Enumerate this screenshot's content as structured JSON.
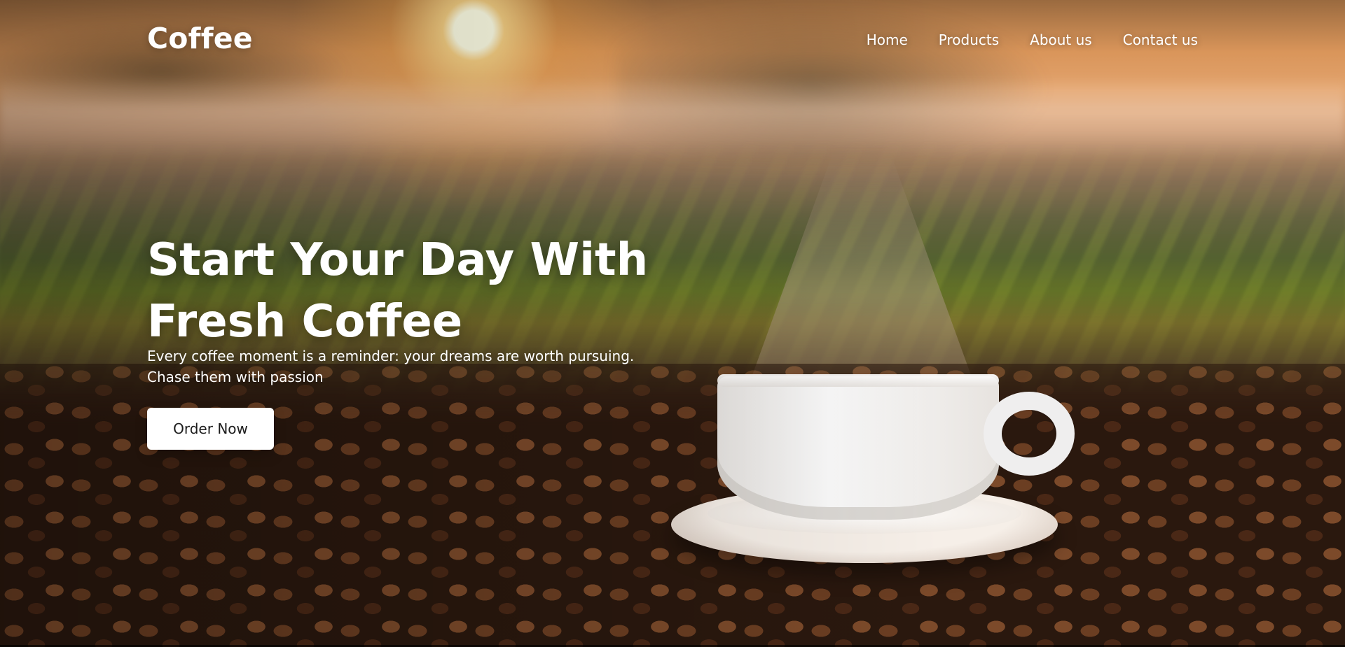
{
  "brand": {
    "name": "Coffee"
  },
  "nav": {
    "items": [
      {
        "label": "Home"
      },
      {
        "label": "Products"
      },
      {
        "label": "About us"
      },
      {
        "label": "Contact us"
      }
    ]
  },
  "hero": {
    "headline_lines": [
      "Start Your Day With",
      "Fresh Coffee"
    ],
    "subtitle_lines": [
      "Every coffee moment is a reminder: your dreams are worth pursuing.",
      "Chase them with passion"
    ],
    "cta_label": "Order Now"
  },
  "theme": {
    "text_color": "#ffffff",
    "button_bg": "#ffffff",
    "button_text": "#1c1c1c"
  },
  "icons": {
    "hero_image": "coffee-cup-on-beans-illustration"
  }
}
